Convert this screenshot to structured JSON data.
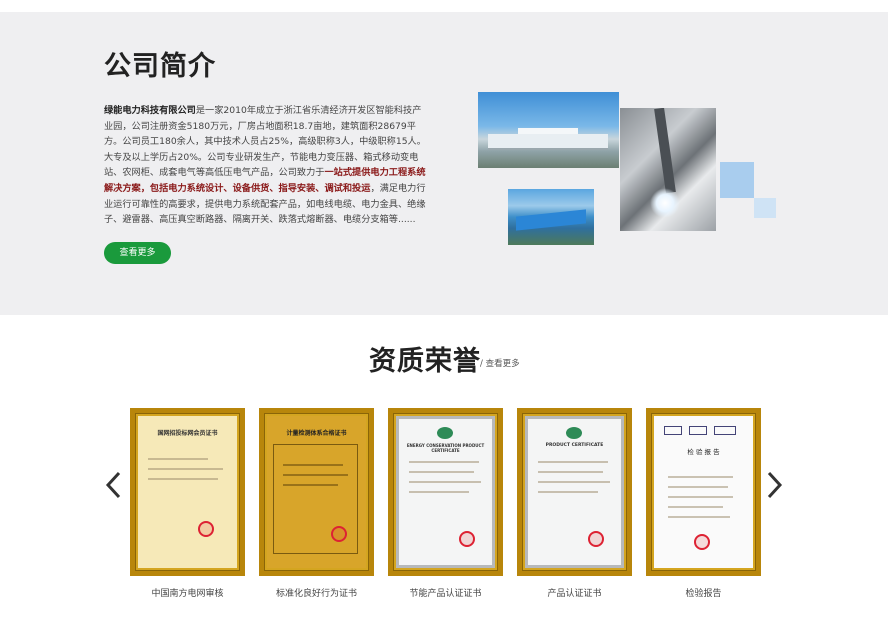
{
  "about": {
    "title": "公司简介",
    "company": "绿能电力科技有限公司",
    "text1": "是一家2010年成立于浙江省乐清经济开发区智能科技产业园，公司注册资金5180万元，厂房占地面积18.7亩地，建筑面积28679平方。公司员工180余人，其中技术人员占25%，高级职称3人，中级职称15人。大专及以上学历占20%。公司专业研发生产，节能电力变压器、箱式移动变电站、农网柜、成套电气等高低压电气产品，公司致力于",
    "highlight": "一站式提供电力工程系统解决方案，包括电力系统设计、设备供货、指导安装、调试和投运",
    "text2": "，满足电力行业运行可靠性的高要求，提供电力系统配套产品，如电线电缆、电力金具、绝缘子、避雷器、高压真空断路器、隔离开关、跌落式熔断器、电缆分支箱等......",
    "more_label": "查看更多"
  },
  "qualification": {
    "title": "资质荣誉",
    "more_label": "/ 查看更多",
    "certs": [
      {
        "label": "中国南方电网审核",
        "heading": "国网招投标网会员证书"
      },
      {
        "label": "标准化良好行为证书",
        "heading": "计量检测体系合格证书"
      },
      {
        "label": "节能产品认证证书",
        "heading": "ENERGY CONSERVATION PRODUCT CERTIFICATE"
      },
      {
        "label": "产品认证证书",
        "heading": "PRODUCT CERTIFICATE"
      },
      {
        "label": "检验报告",
        "heading": "检 验 报 告"
      }
    ]
  },
  "icons": {
    "prev": "chevron-left-icon",
    "next": "chevron-right-icon"
  },
  "colors": {
    "accent": "#1a9a3c",
    "highlight_text": "#8b1a1a",
    "section_bg": "#efeff1",
    "frame_gold": "#b8860b"
  }
}
